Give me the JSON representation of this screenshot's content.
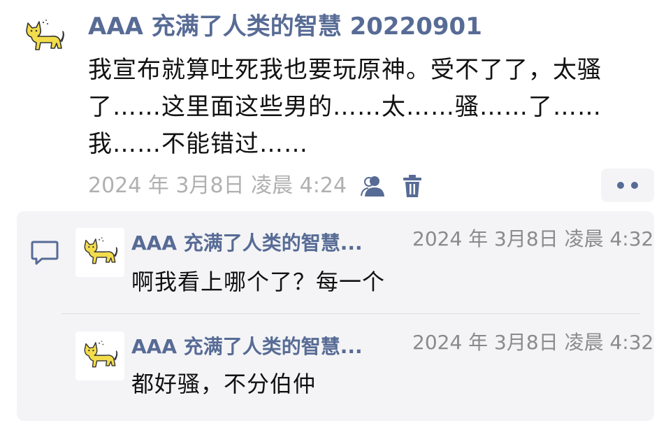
{
  "post": {
    "author": "AAA 充满了人类的智慧 20220901",
    "text": "我宣布就算吐死我也要玩原神。受不了了，太骚了……这里面这些男的……太……骚……了……我……不能错过……",
    "time": "2024 年 3月8日 凌晨 4:24",
    "avatar_icon": "yellow-cat-icon",
    "actions": {
      "visibility_icon": "person-icon",
      "delete_icon": "trash-icon",
      "more_icon": "more-dots-icon"
    }
  },
  "comments_section": {
    "icon": "comment-icon",
    "items": [
      {
        "author": "AAA 充满了人类的智慧...",
        "time": "2024 年 3月8日 凌晨 4:32",
        "text": "啊我看上哪个了？每一个"
      },
      {
        "author": "AAA 充满了人类的智慧...",
        "time": "2024 年 3月8日 凌晨 4:32",
        "text": "都好骚，不分伯仲"
      }
    ]
  },
  "colors": {
    "accent": "#576b95",
    "cat": "#f2dc4b",
    "panel": "#f4f4f6",
    "meta": "#b0b0b0"
  }
}
